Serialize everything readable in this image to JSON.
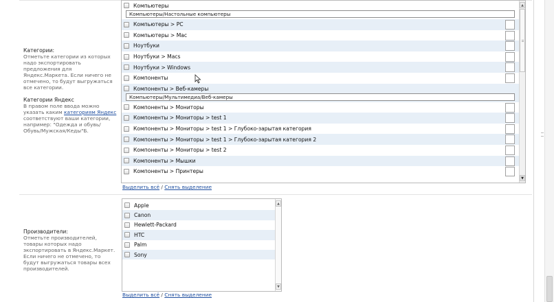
{
  "categories_help": {
    "title": "Категории:",
    "text": "Отметьте категории из которых надо экспортировать предложения для Яндекс.Маркета. Если ничего не отмечено, то будут выгружаться все категории.",
    "yandex_title": "Категории Яндекс",
    "yandex_text_before": "В правом поле ввода можно указать каким ",
    "yandex_link": "категориям Яндекс",
    "yandex_text_after": " соответствуют ваши категории, например: \"Одежда и обувь/Обувь/Мужская/Кеды\"Б."
  },
  "categories": [
    {
      "label": "Компьютеры",
      "mapping": "Компьютеры/Настольные компьютеры"
    },
    {
      "label": "Компьютеры > PC",
      "mapping": ""
    },
    {
      "label": "Компьютеры > Mac",
      "mapping": ""
    },
    {
      "label": "Ноутбуки",
      "mapping": ""
    },
    {
      "label": "Ноутбуки > Macs",
      "mapping": ""
    },
    {
      "label": "Ноутбуки > Windows",
      "mapping": ""
    },
    {
      "label": "Компоненты",
      "mapping": ""
    },
    {
      "label": "Компоненты > Веб-камеры",
      "mapping": "Компьютеры/Мультимедиа/Веб-камеры"
    },
    {
      "label": "Компоненты > Мониторы",
      "mapping": ""
    },
    {
      "label": "Компоненты > Мониторы > test 1",
      "mapping": ""
    },
    {
      "label": "Компоненты > Мониторы > test 1 > Глубоко-зарытая категория",
      "mapping": ""
    },
    {
      "label": "Компоненты > Мониторы > test 1 > Глубоко-зарытая категория 2",
      "mapping": ""
    },
    {
      "label": "Компоненты > Мониторы > test 2",
      "mapping": ""
    },
    {
      "label": "Компоненты > Мышки",
      "mapping": ""
    },
    {
      "label": "Компоненты > Принтеры",
      "mapping": ""
    }
  ],
  "categories_links": {
    "select_all": "Выделить всё",
    "separator": " / ",
    "deselect": "Снять выделение"
  },
  "manufacturers_help": {
    "title": "Производители:",
    "text": "Отметьте производителей, товары которых надо экспортировать в Яндекс.Маркет. Если ничего не отмечено, то будут выгружаться товары всех производителей."
  },
  "manufacturers": [
    "Apple",
    "Canon",
    "Hewlett-Packard",
    "HTC",
    "Palm",
    "Sony"
  ],
  "manufacturers_links": {
    "select_all": "Выделить всё",
    "separator": " / ",
    "deselect": "Снять выделение"
  },
  "icons": {
    "scroll_up": "chevron-up-icon",
    "scroll_down": "chevron-down-icon",
    "cursor": "mouse-pointer-icon"
  }
}
